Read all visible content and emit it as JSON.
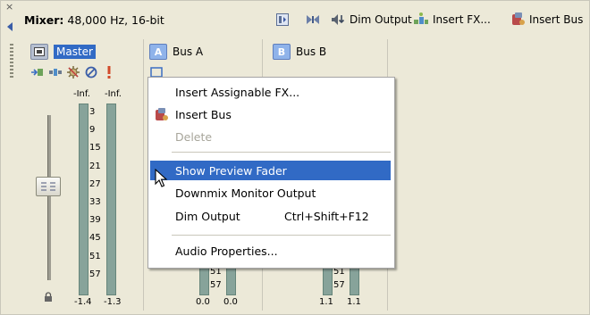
{
  "mixer": {
    "title_bold": "Mixer:",
    "title_rest": " 48,000 Hz, 16-bit"
  },
  "toolbar": {
    "dim_output": "Dim Output",
    "insert_fx": "Insert FX...",
    "insert_bus": "Insert Bus"
  },
  "strips": [
    {
      "name": "Master",
      "chip": "",
      "peak_left": "-Inf.",
      "peak_right": "-Inf.",
      "level_left": "-1.4",
      "level_right": "-1.3"
    },
    {
      "name": "Bus A",
      "chip": "A",
      "level_left": "0.0",
      "level_right": "0.0"
    },
    {
      "name": "Bus B",
      "chip": "B",
      "level_left": "1.1",
      "level_right": "1.1"
    }
  ],
  "meter_scale": [
    "3",
    "9",
    "15",
    "21",
    "27",
    "33",
    "39",
    "45",
    "51",
    "57"
  ],
  "bus_scale_visible": [
    "51",
    "57"
  ],
  "menu": {
    "items": [
      {
        "label": "Insert Assignable FX...",
        "shortcut": "",
        "enabled": true
      },
      {
        "label": "Insert Bus",
        "shortcut": "",
        "enabled": true
      },
      {
        "label": "Delete",
        "shortcut": "",
        "enabled": false
      },
      {
        "label": "Show Preview Fader",
        "shortcut": "",
        "enabled": true,
        "highlighted": true
      },
      {
        "label": "Downmix Monitor Output",
        "shortcut": "",
        "enabled": true
      },
      {
        "label": "Dim Output",
        "shortcut": "Ctrl+Shift+F12",
        "enabled": true
      },
      {
        "label": "Audio Properties...",
        "shortcut": "",
        "enabled": true
      }
    ]
  },
  "colors": {
    "highlight": "#316ac5",
    "meter": "#87a39a",
    "panel": "#ece9d8"
  }
}
